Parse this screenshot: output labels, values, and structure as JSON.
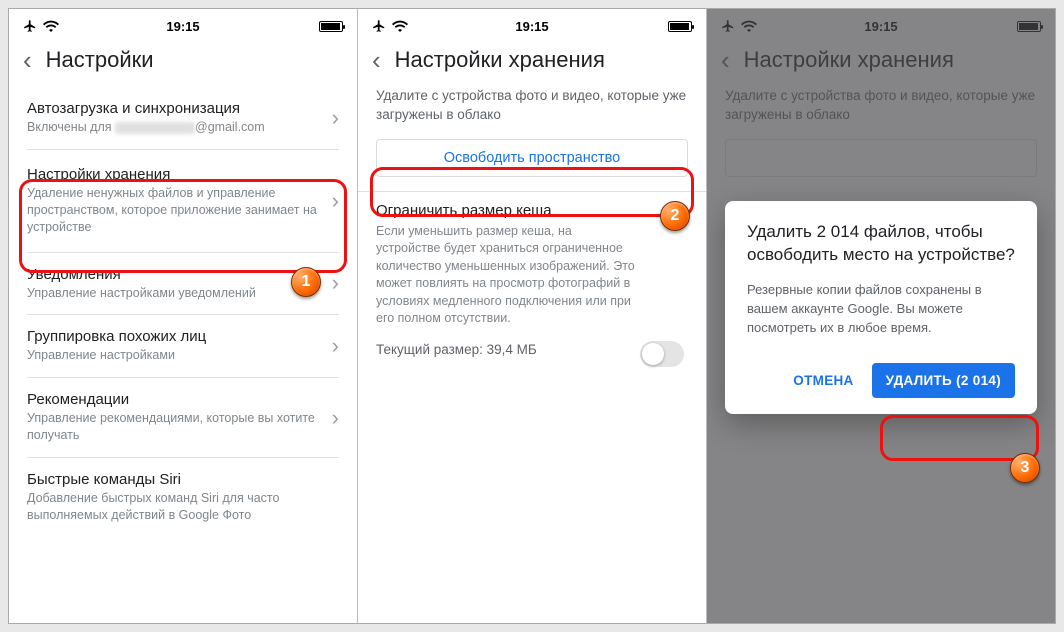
{
  "status": {
    "time": "19:15"
  },
  "colors": {
    "accent": "#1a73e8",
    "highlight": "#e11"
  },
  "screen1": {
    "title": "Настройки",
    "items": [
      {
        "title": "Автозагрузка и синхронизация",
        "desc_prefix": "Включены для",
        "desc_suffix": "@gmail.com"
      },
      {
        "title": "Настройки хранения",
        "desc": "Удаление ненужных файлов и управление пространством, которое приложение занимает на устройстве"
      },
      {
        "title": "Уведомления",
        "desc": "Управление настройками уведомлений"
      },
      {
        "title": "Группировка похожих лиц",
        "desc": "Управление настройками"
      },
      {
        "title": "Рекомендации",
        "desc": "Управление рекомендациями, которые вы хотите получать"
      },
      {
        "title": "Быстрые команды Siri",
        "desc": "Добавление быстрых команд Siri для часто выполняемых действий в Google Фото"
      }
    ]
  },
  "screen2": {
    "title": "Настройки хранения",
    "intro": "Удалите с устройства фото и видео, которые уже загружены в облако",
    "free_space": "Освободить пространство",
    "cache_title": "Ограничить размер кеша",
    "cache_desc": "Если уменьшить размер кеша, на устройстве будет храниться ограниченное количество уменьшенных изображений. Это может повлиять на просмотр фотографий в условиях медленного подключения или при его полном отсутствии.",
    "current_size": "Текущий размер: 39,4 МБ"
  },
  "screen3": {
    "title": "Настройки хранения",
    "intro": "Удалите с устройства фото и видео, которые уже загружены в облако",
    "dialog_title": "Удалить 2 014 файлов, чтобы освободить место на устройстве?",
    "dialog_body": "Резервные копии файлов сохранены в вашем аккаунте Google. Вы можете посмотреть их в любое время.",
    "cancel": "ОТМЕНА",
    "delete": "УДАЛИТЬ (2 014)"
  },
  "badges": [
    "1",
    "2",
    "3"
  ]
}
